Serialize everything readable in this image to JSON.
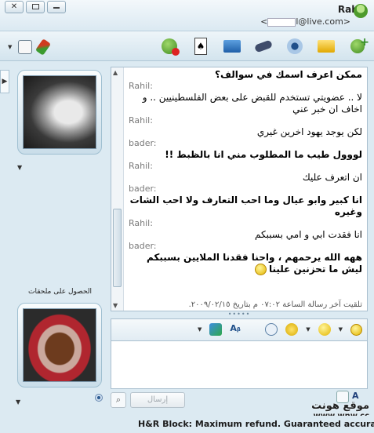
{
  "window": {
    "minimize_icon": "minimize-icon",
    "restore_icon": "restore-icon",
    "close_label": "✕"
  },
  "contact": {
    "name": "Rahil",
    "email_prefix": "<",
    "email_suffix": "l@live.com>"
  },
  "toolbar": {
    "icons": [
      "block-contact-icon",
      "games-icon",
      "video-icon",
      "call-icon",
      "webcam-icon",
      "share-folder-icon",
      "add-contact-icon"
    ]
  },
  "history": {
    "messages": [
      {
        "text": "ممكن اعرف اسمك في سوالف؟",
        "bold": true
      },
      {
        "sender": "Rahil:"
      },
      {
        "text": "لا .. عضويتي تستخدم للقبض على بعض الفلسطينيين .. و اخاف ان خبر عني"
      },
      {
        "sender": "Rahil:"
      },
      {
        "text": "لكن يوجد يهود اخرين غيري"
      },
      {
        "sender": "bader:"
      },
      {
        "text": "لووول طيب ما المطلوب مني انا بالظبط !!",
        "bold": true
      },
      {
        "sender": "Rahil:"
      },
      {
        "text": "ان اتعرف عليك"
      },
      {
        "sender": "bader:"
      },
      {
        "text": "انا كبير وابو عيال وما احب التعارف ولا احب الشات وغيره",
        "bold": true
      },
      {
        "sender": "Rahil:"
      },
      {
        "text": "انا فقدت ابي و امي بسببكم"
      },
      {
        "sender": "bader:"
      },
      {
        "text": "ههه الله يرحمهم ، واحنا فقدنا الملايين بسببكم ليش ما تحزنين علينا",
        "bold": true,
        "smiley": true
      }
    ],
    "footer_note": "تلقيت آخر رسالة الساعة ٠٧:٠٢ م بتاريخ ٢٠٠٩/٠٢/١٥."
  },
  "splitter": "•••••",
  "input": {
    "send_label": "إرسال",
    "search_label": "⌕"
  },
  "left": {
    "gift_label": "الحصول على ملحقات"
  },
  "watermark": {
    "title": "موقع هونت",
    "url": "www.wnw.cc"
  },
  "ad": {
    "text": "H&R Block: Maximum refund. Guaranteed accuracy."
  }
}
